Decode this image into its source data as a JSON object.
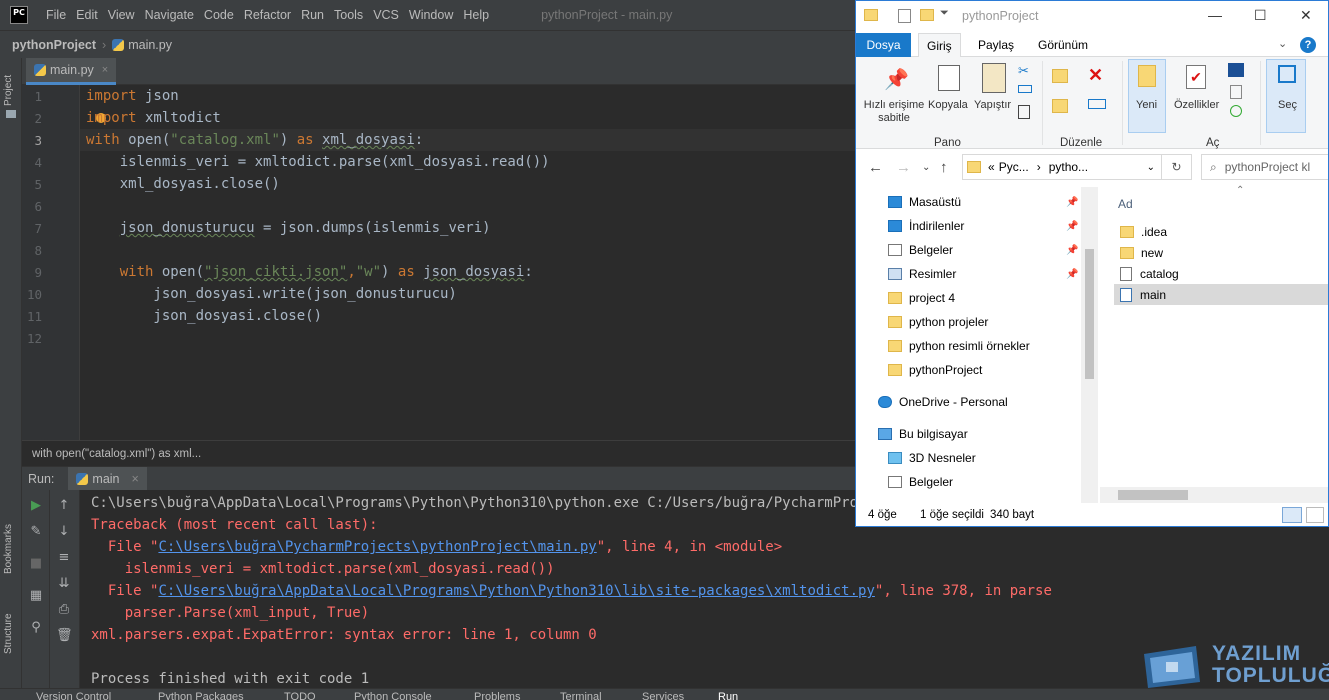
{
  "pycharm": {
    "logo_text": "PC",
    "menu": [
      "File",
      "Edit",
      "View",
      "Navigate",
      "Code",
      "Refactor",
      "Run",
      "Tools",
      "VCS",
      "Window",
      "Help"
    ],
    "window_title": "pythonProject - main.py",
    "breadcrumb": {
      "project": "pythonProject",
      "file": "main.py"
    },
    "left_strip": {
      "project_label": "Project",
      "bookmarks_label": "Bookmarks",
      "structure_label": "Structure"
    },
    "editor_tab": {
      "label": "main.py",
      "close": "×"
    },
    "line_numbers": [
      "1",
      "2",
      "3",
      "4",
      "5",
      "6",
      "7",
      "8",
      "9",
      "10",
      "11",
      "12"
    ],
    "code": {
      "l1_kw": "import",
      "l1_rest": " json",
      "l2_kw": "import",
      "l2_rest": " xmltodict",
      "l3_kw": "with",
      "l3_a": " open(",
      "l3_str": "\"catalog.xml\"",
      "l3_b": ") ",
      "l3_kw2": "as",
      "l3_c": " ",
      "l3_var": "xml_dosyasi",
      "l3_d": ":",
      "l4": "    islenmis_veri = xmltodict.parse(xml_dosyasi.read())",
      "l5": "    xml_dosyasi.close()",
      "l7a": "    ",
      "l7_var": "json_donusturucu",
      "l7b": " = json.dumps(islenmis_veri)",
      "l9_indent": "    ",
      "l9_kw": "with",
      "l9_a": " open(",
      "l9_str1": "\"json_cikti.json\"",
      "l9_comma": ",",
      "l9_str2": "\"w\"",
      "l9_b": ") ",
      "l9_kw2": "as",
      "l9_c": " ",
      "l9_var": "json_dosyasi",
      "l9_d": ":",
      "l10": "        json_dosyasi.write(json_donusturucu)",
      "l11": "        json_dosyasi.close()"
    },
    "editor_breadcrumb": "with open(\"catalog.xml\") as xml...",
    "run_panel": {
      "label": "Run:",
      "tab": "main"
    },
    "console": {
      "l1": "C:\\Users\\buğra\\AppData\\Local\\Programs\\Python\\Python310\\python.exe C:/Users/buğra/PycharmProjects/pythonProject/main.py",
      "l2": "Traceback (most recent call last):",
      "l3_a": "  File \"",
      "l3_link": "C:\\Users\\buğra\\PycharmProjects\\pythonProject\\main.py",
      "l3_b": "\", line 4, in <module>",
      "l4": "    islenmis_veri = xmltodict.parse(xml_dosyasi.read())",
      "l5_a": "  File \"",
      "l5_link": "C:\\Users\\buğra\\AppData\\Local\\Programs\\Python\\Python310\\lib\\site-packages\\xmltodict.py",
      "l5_b": "\", line 378, in parse",
      "l6": "    parser.Parse(xml_input, True)",
      "l7": "xml.parsers.expat.ExpatError: syntax error: line 1, column 0",
      "l9": "Process finished with exit code 1"
    },
    "statusbar": [
      "Version Control",
      "Python Packages",
      "TODO",
      "Python Console",
      "Problems",
      "Terminal",
      "Services",
      "Run"
    ]
  },
  "explorer": {
    "title": "pythonProject",
    "window_buttons": {
      "minimize": "—",
      "maximize": "☐",
      "close": "✕"
    },
    "tabs": [
      "Dosya",
      "Giriş",
      "Paylaş",
      "Görünüm"
    ],
    "ribbon": {
      "pin": "Hızlı erişime sabitle",
      "copy": "Kopyala",
      "paste": "Yapıştır",
      "group_pano": "Pano",
      "group_duzenle": "Düzenle",
      "new": "Yeni",
      "properties": "Özellikler",
      "group_ac": "Aç",
      "select": "Seç"
    },
    "address": {
      "part1": "Pyc...",
      "part2": "pytho...",
      "search_placeholder": "pythonProject kl"
    },
    "nav_items": [
      {
        "label": "Masaüstü"
      },
      {
        "label": "İndirilenler"
      },
      {
        "label": "Belgeler"
      },
      {
        "label": "Resimler"
      },
      {
        "label": "project 4"
      },
      {
        "label": "python projeler"
      },
      {
        "label": "python resimli örnekler"
      },
      {
        "label": "pythonProject"
      },
      {
        "label": "OneDrive - Personal"
      },
      {
        "label": "Bu bilgisayar"
      },
      {
        "label": "3D Nesneler"
      },
      {
        "label": "Belgeler"
      }
    ],
    "column_header": "Ad",
    "files": [
      ".idea",
      "new",
      "catalog",
      "main"
    ],
    "status": {
      "count": "4 öğe",
      "selected": "1 öğe seçildi",
      "size": "340 bayt"
    }
  },
  "watermark": {
    "line1": "YAZILIM",
    "line2": "TOPLULUĞU"
  },
  "colors": {
    "ide_bg": "#2b2b2b",
    "keyword": "#cc7832",
    "string": "#6a8759",
    "error": "#ff6b68",
    "link": "#5394ec",
    "explorer_accent": "#1979ca"
  }
}
